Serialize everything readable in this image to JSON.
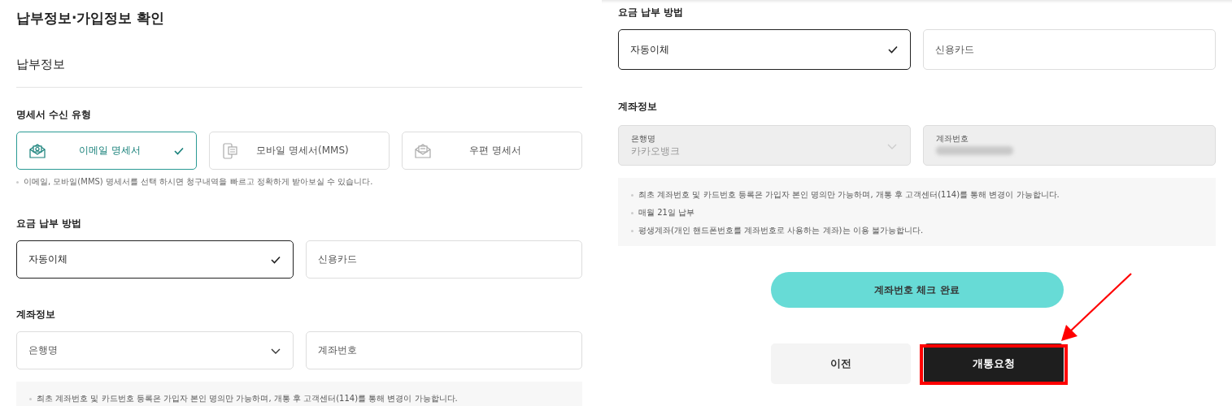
{
  "left_panel": {
    "title": "납부정보·가입정보 확인",
    "section_title": "납부정보",
    "statement_type": {
      "label": "명세서 수신 유형",
      "options": [
        {
          "label": "이메일 명세서",
          "selected": true
        },
        {
          "label": "모바일 명세서(MMS)",
          "selected": false
        },
        {
          "label": "우편 명세서",
          "selected": false
        }
      ],
      "note": "이메일, 모바일(MMS) 명세서를 선택 하시면 청구내역을 빠르고 정확하게 받아보실 수 있습니다."
    },
    "payment_method": {
      "label": "요금 납부 방법",
      "options": [
        {
          "label": "자동이체",
          "selected": true
        },
        {
          "label": "신용카드",
          "selected": false
        }
      ]
    },
    "account": {
      "label": "계좌정보",
      "bank": {
        "placeholder": "은행명"
      },
      "account_number": {
        "placeholder": "계좌번호"
      }
    },
    "info": [
      "최초 계좌번호 및 카드번호 등록은 가입자 본인 명의만 가능하며, 개통 후 고객센터(114)를 통해 변경이 가능합니다."
    ]
  },
  "right_panel": {
    "payment_method": {
      "label": "요금 납부 방법",
      "options": [
        {
          "label": "자동이체",
          "selected": true
        },
        {
          "label": "신용카드",
          "selected": false
        }
      ]
    },
    "account": {
      "label": "계좌정보",
      "bank": {
        "label": "은행명",
        "value": "카카오뱅크",
        "disabled": true
      },
      "account_number": {
        "label": "계좌번호",
        "disabled": true
      }
    },
    "info": [
      "최초 계좌번호 및 카드번호 등록은 가입자 본인 명의만 가능하며, 개통 후 고객센터(114)를 통해 변경이 가능합니다.",
      "매월 21일 납부",
      "평생계좌(개인 핸드폰번호를 계좌번호로 사용하는 계좌)는 이용 불가능합니다."
    ],
    "check_button": "계좌번호 체크 완료",
    "buttons": [
      {
        "label": "이전",
        "kind": "secondary",
        "highlighted": false
      },
      {
        "label": "개통요청",
        "kind": "primary",
        "highlighted": true
      }
    ]
  }
}
